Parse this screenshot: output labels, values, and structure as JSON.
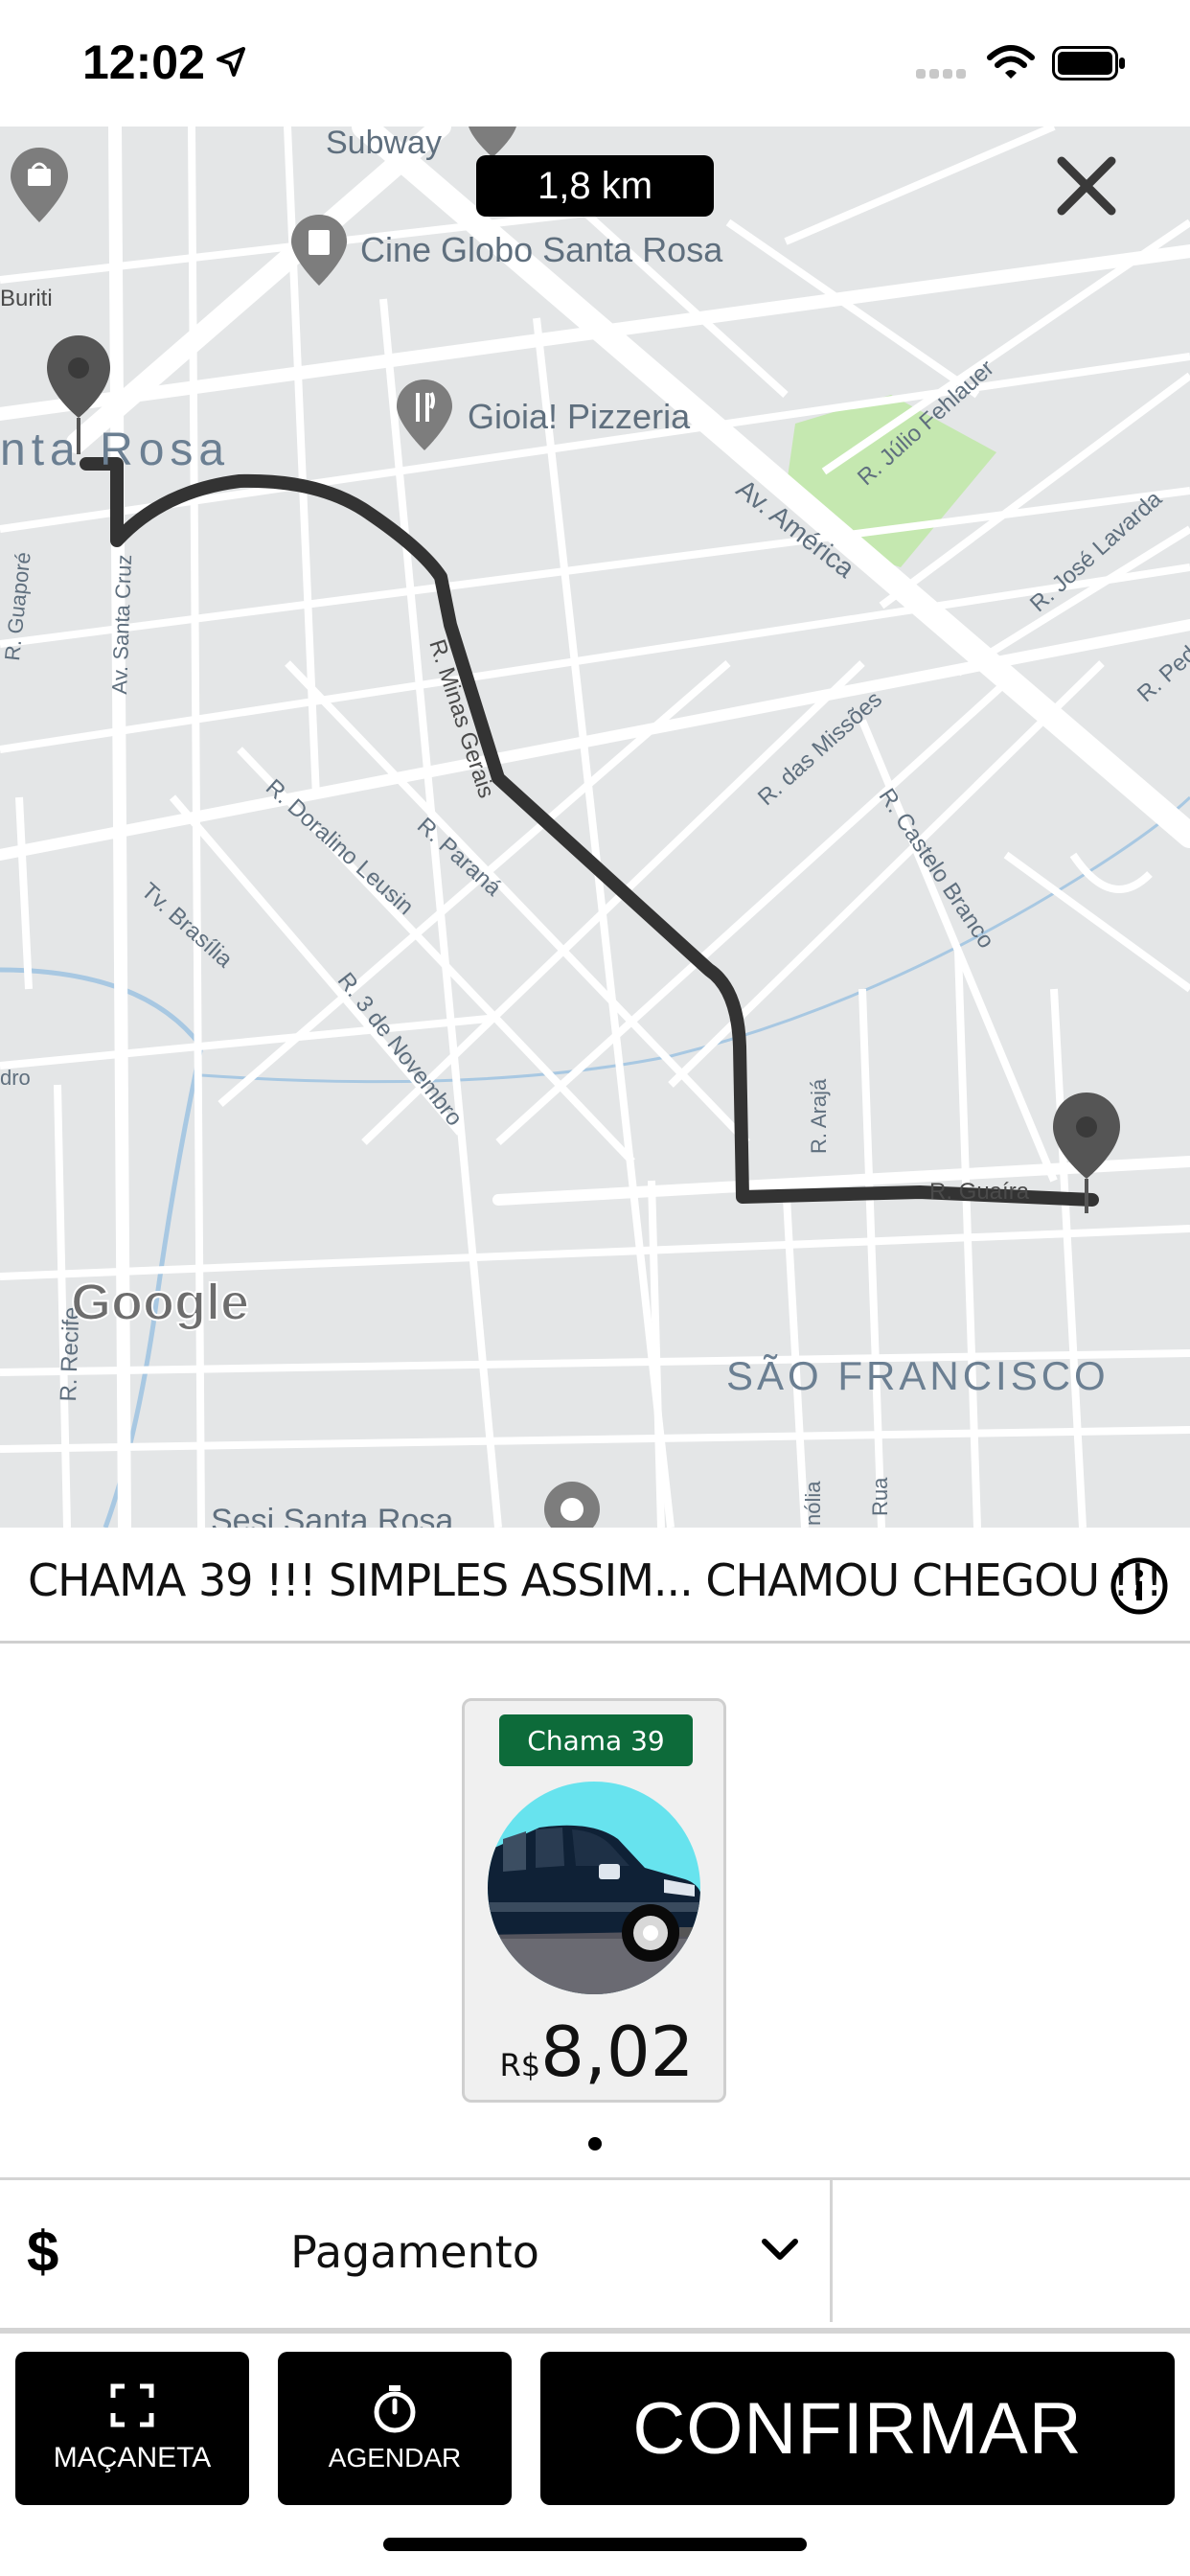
{
  "status_bar": {
    "time": "12:02",
    "icons": [
      "location-arrow-icon",
      "signal-icon",
      "wifi-icon",
      "battery-icon"
    ]
  },
  "map": {
    "distance": "1,8 km",
    "labels": {
      "subway": "Subway",
      "cine": "Cine Globo Santa Rosa",
      "buriti": "Buriti",
      "santa_rosa": "nta Rosa",
      "gioia": "Gioia! Pizzeria",
      "julio": "R. Júlio Fehlauer",
      "america": "Av. América",
      "jose": "R. José Lavarda",
      "pedro": "R. Pedr",
      "guapore": "R. Guaporé",
      "santa_cruz": "Av. Santa Cruz",
      "minas": "R. Minas Gerais",
      "missoes": "R. das Missões",
      "castelo": "R. Castelo Branco",
      "doralino": "R. Doralino Leusin",
      "parana": "R. Paraná",
      "brasilia": "Tv. Brasília",
      "novembro": "R. 3 de Novembro",
      "araja": "R. Arajá",
      "guaira": "R. Guaíra",
      "dro": "dro",
      "recife": "R. Recife",
      "sao_francisco": "SÃO FRANCISCO",
      "sesi": "Sesi Santa Rosa",
      "nolia": "nólia",
      "rua": "Rua"
    },
    "google": "Google",
    "close_icon": "close-icon"
  },
  "banner": {
    "text": "CHAMA 39 !!! SIMPLES ASSIM... CHAMOU CHEGOU !!!",
    "info_icon": "info-icon"
  },
  "vehicle_card": {
    "name": "Chama 39",
    "currency": "R$",
    "price": "8,02",
    "image": "car-icon"
  },
  "payment": {
    "icon": "$",
    "label": "Pagamento",
    "chevron": "chevron-down-icon"
  },
  "actions": {
    "macaneta": "MAÇANETA",
    "agendar": "AGENDAR",
    "confirmar": "CONFIRMAR"
  },
  "colors": {
    "map_bg": "#e4e6e7",
    "route": "#333333",
    "park": "#c5e8b0",
    "tag_green": "#0d6b3a",
    "button_black": "#000000"
  }
}
